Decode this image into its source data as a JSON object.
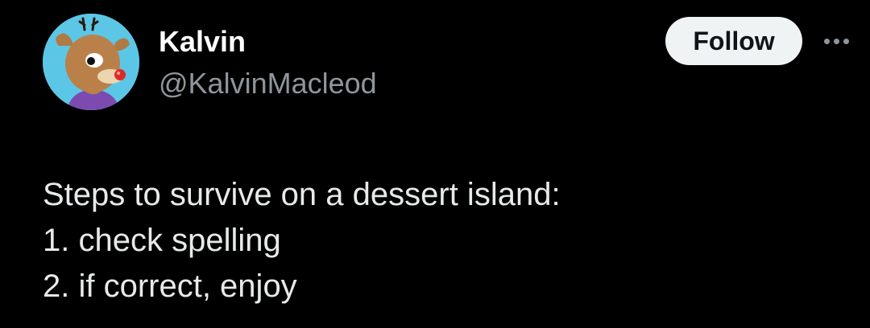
{
  "author": {
    "display_name": "Kalvin",
    "handle": "@KalvinMacleod",
    "avatar_icon": "reindeer-avatar"
  },
  "actions": {
    "follow_label": "Follow",
    "more_icon": "more-horizontal-icon"
  },
  "tweet": {
    "lines": [
      "Steps to survive on a dessert island:",
      "1. check spelling",
      "2. if correct, enjoy"
    ]
  },
  "colors": {
    "background": "#000000",
    "name": "#ffffff",
    "handle": "#8f959b",
    "text": "#e7e9ea",
    "follow_bg": "#eff3f4",
    "follow_text": "#0f1419",
    "avatar_bg": "#5cc6e6"
  }
}
